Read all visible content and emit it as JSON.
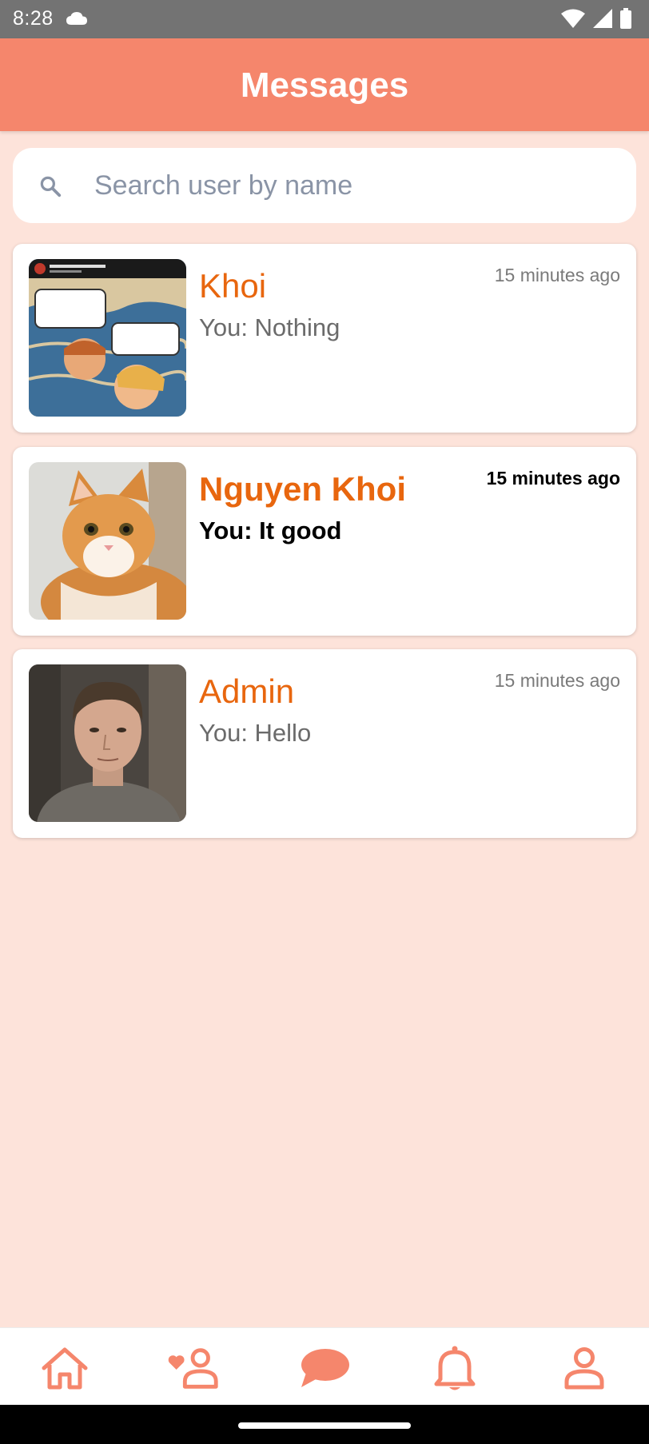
{
  "status_bar": {
    "time": "8:28",
    "icons": [
      "cloud-icon",
      "wifi-icon",
      "cell-signal-icon",
      "battery-icon"
    ]
  },
  "header": {
    "title": "Messages"
  },
  "search": {
    "placeholder": "Search user by name",
    "value": ""
  },
  "conversations": [
    {
      "name": "Khoi",
      "preview": "You: Nothing",
      "time": "15 minutes ago",
      "unread": false
    },
    {
      "name": "Nguyen Khoi",
      "preview": "You: It good",
      "time": "15 minutes ago",
      "unread": true
    },
    {
      "name": "Admin",
      "preview": "You: Hello",
      "time": "15 minutes ago",
      "unread": false
    }
  ],
  "bottom_nav": {
    "items": [
      "home-icon",
      "friends-icon",
      "chat-icon",
      "bell-icon",
      "profile-icon"
    ],
    "active": "chat-icon"
  },
  "colors": {
    "accent": "#f5866c",
    "background": "#fde3da",
    "name_text": "#e8660e"
  }
}
